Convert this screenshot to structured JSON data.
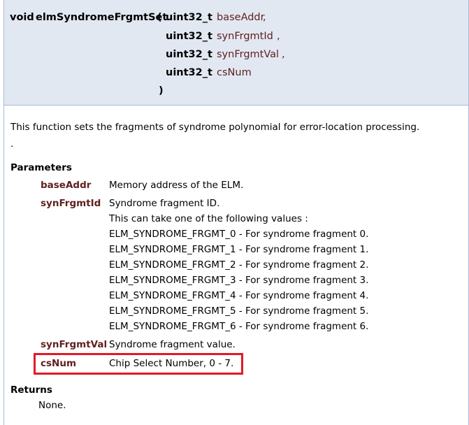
{
  "prototype": {
    "return_type": "void",
    "function_name": "elmSyndromeFrgmtSet",
    "open_paren": "(",
    "close_paren": ")",
    "params": [
      {
        "type": "uint32_t",
        "name": "baseAddr",
        "sep": ","
      },
      {
        "type": "uint32_t",
        "name": "synFrgmtId",
        "sep": ","
      },
      {
        "type": "uint32_t",
        "name": "synFrgmtVal",
        "sep": ","
      },
      {
        "type": "uint32_t",
        "name": "csNum",
        "sep": ""
      }
    ]
  },
  "description": {
    "text": "This function sets the fragments of syndrome polynomial for error-location processing.",
    "dot": "."
  },
  "parameters_heading": "Parameters",
  "parameters": [
    {
      "name": "baseAddr",
      "lines": [
        "Memory address of the ELM."
      ]
    },
    {
      "name": "synFrgmtId",
      "lines": [
        "Syndrome fragment ID.",
        "This can take one of the following values :",
        "ELM_SYNDROME_FRGMT_0 - For syndrome fragment 0.",
        "ELM_SYNDROME_FRGMT_1 - For syndrome fragment 1.",
        "ELM_SYNDROME_FRGMT_2 - For syndrome fragment 2.",
        "ELM_SYNDROME_FRGMT_3 - For syndrome fragment 3.",
        "ELM_SYNDROME_FRGMT_4 - For syndrome fragment 4.",
        "ELM_SYNDROME_FRGMT_5 - For syndrome fragment 5.",
        "ELM_SYNDROME_FRGMT_6 - For syndrome fragment 6."
      ]
    },
    {
      "name": "synFrgmtVal",
      "lines": [
        "Syndrome fragment value."
      ]
    },
    {
      "name": "csNum",
      "lines": [
        "Chip Select Number, 0 - 7."
      ]
    }
  ],
  "returns_heading": "Returns",
  "returns_text": "None.",
  "colors": {
    "header_bg": "#e2e8f2",
    "header_border": "#a8b8d9",
    "param_name": "#602020",
    "highlight": "#e01b24"
  }
}
